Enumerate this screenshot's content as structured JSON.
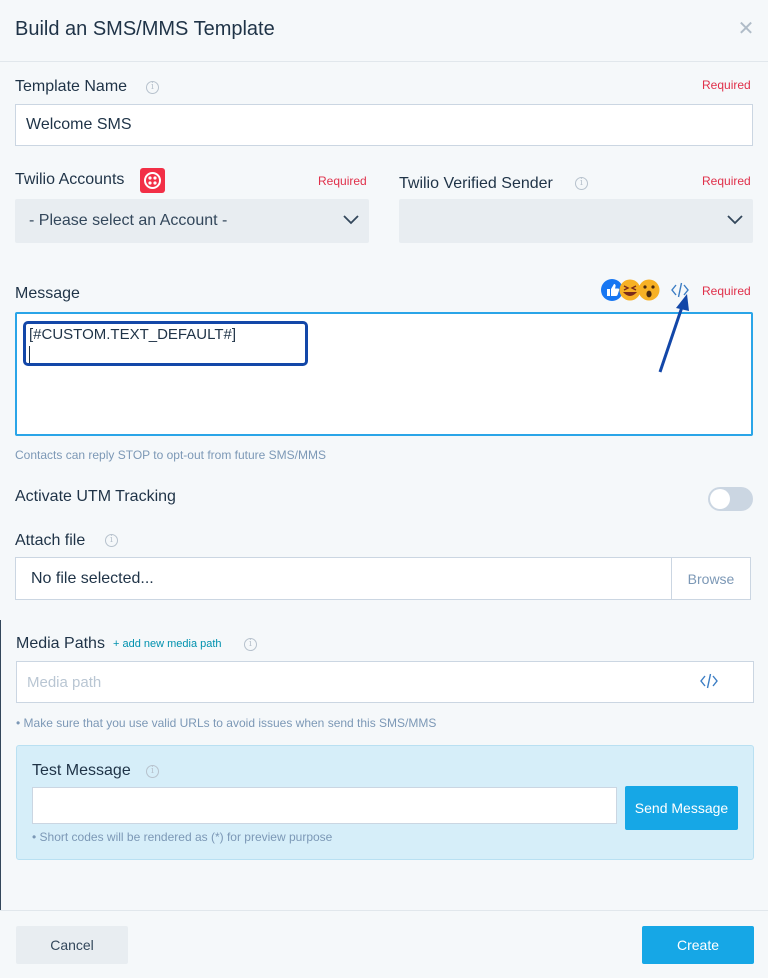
{
  "header": {
    "title": "Build an SMS/MMS Template",
    "close_icon": "close-icon"
  },
  "template_name": {
    "label": "Template Name",
    "required": "Required",
    "value": "Welcome SMS"
  },
  "twilio_accounts": {
    "label": "Twilio Accounts",
    "required": "Required",
    "selected": "- Please select an Account -",
    "icon": "twilio-icon",
    "icon_color": "#f22f46"
  },
  "verified_sender": {
    "label": "Twilio Verified Sender",
    "required": "Required",
    "selected": ""
  },
  "message": {
    "label": "Message",
    "required": "Required",
    "value": "[#CUSTOM.TEXT_DEFAULT#]",
    "help": "Contacts can reply STOP to opt-out from future SMS/MMS",
    "emoji_icons": [
      "thumbs-up-icon",
      "laughing-face-icon",
      "surprised-face-icon"
    ],
    "code_icon": "code-icon"
  },
  "utm": {
    "label": "Activate UTM Tracking",
    "enabled": false
  },
  "attach": {
    "label": "Attach file",
    "value": "No file selected...",
    "browse": "Browse"
  },
  "media": {
    "label": "Media Paths",
    "add_link": "+ add new media path",
    "placeholder": "Media path",
    "help": "• Make sure that you use valid URLs to avoid issues when send this SMS/MMS"
  },
  "test": {
    "label": "Test Message",
    "value": "",
    "send": "Send Message",
    "help": "• Short codes will be rendered as (*) for preview purpose"
  },
  "footer": {
    "cancel": "Cancel",
    "create": "Create"
  },
  "colors": {
    "accent": "#16a7e6",
    "required": "#e0304a",
    "highlight": "#1347a8"
  }
}
